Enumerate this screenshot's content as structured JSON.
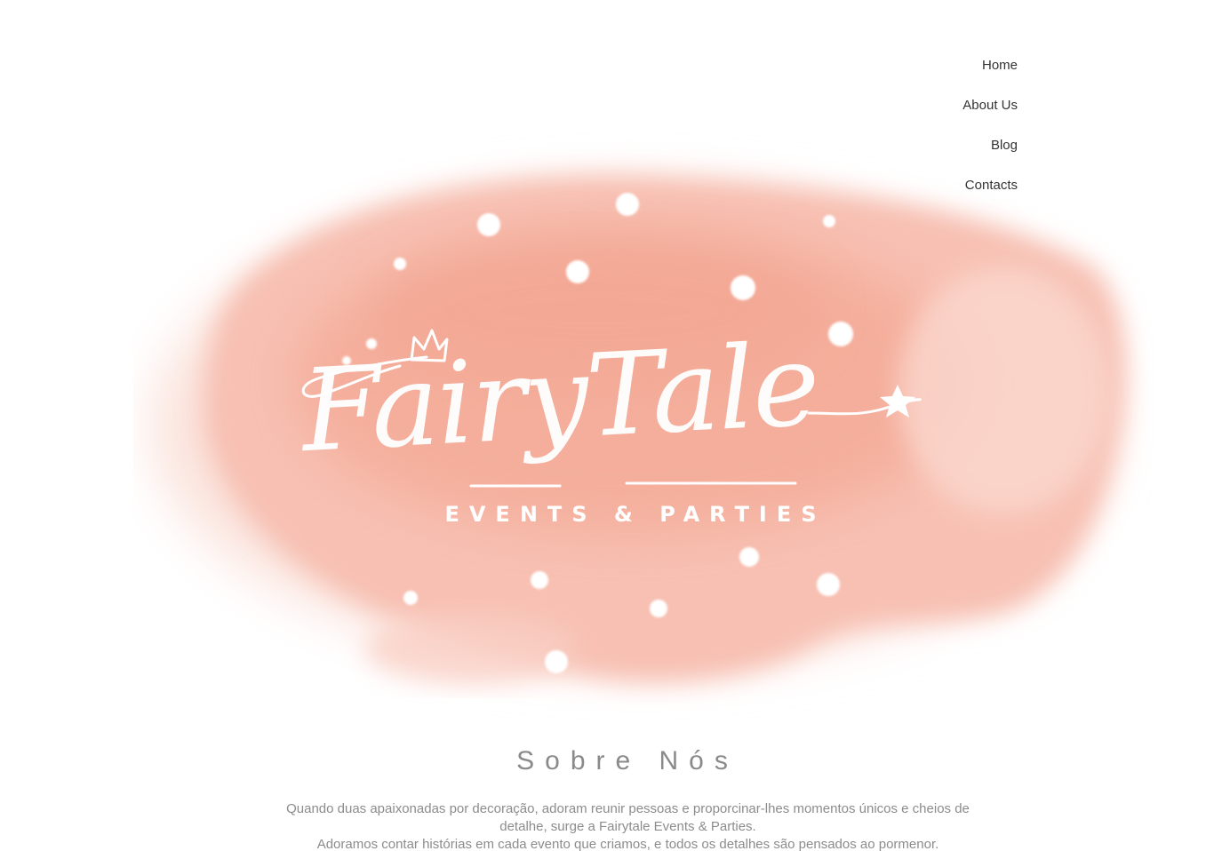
{
  "nav": {
    "items": [
      {
        "label": "Home"
      },
      {
        "label": "About Us"
      },
      {
        "label": "Blog"
      },
      {
        "label": "Contacts"
      }
    ]
  },
  "hero": {
    "logo_title": "FairyTale",
    "logo_subtitle": "EVENTS & PARTIES",
    "colors": {
      "watercolor": "#f6b7a8",
      "logo": "#ffffff"
    }
  },
  "about": {
    "title": "Sobre Nós",
    "paragraph_1": "Quando duas apaixonadas por decoração, adoram reunir pessoas e proporcinar-lhes momentos únicos e cheios de detalhe, surge a Fairytale Events & Parties.",
    "paragraph_2": "Adoramos contar histórias em cada evento que criamos, e todos os detalhes são pensados ao pormenor."
  },
  "colors": {
    "nav_text": "#333333",
    "body_text": "#8c8c8c",
    "background": "#ffffff"
  }
}
